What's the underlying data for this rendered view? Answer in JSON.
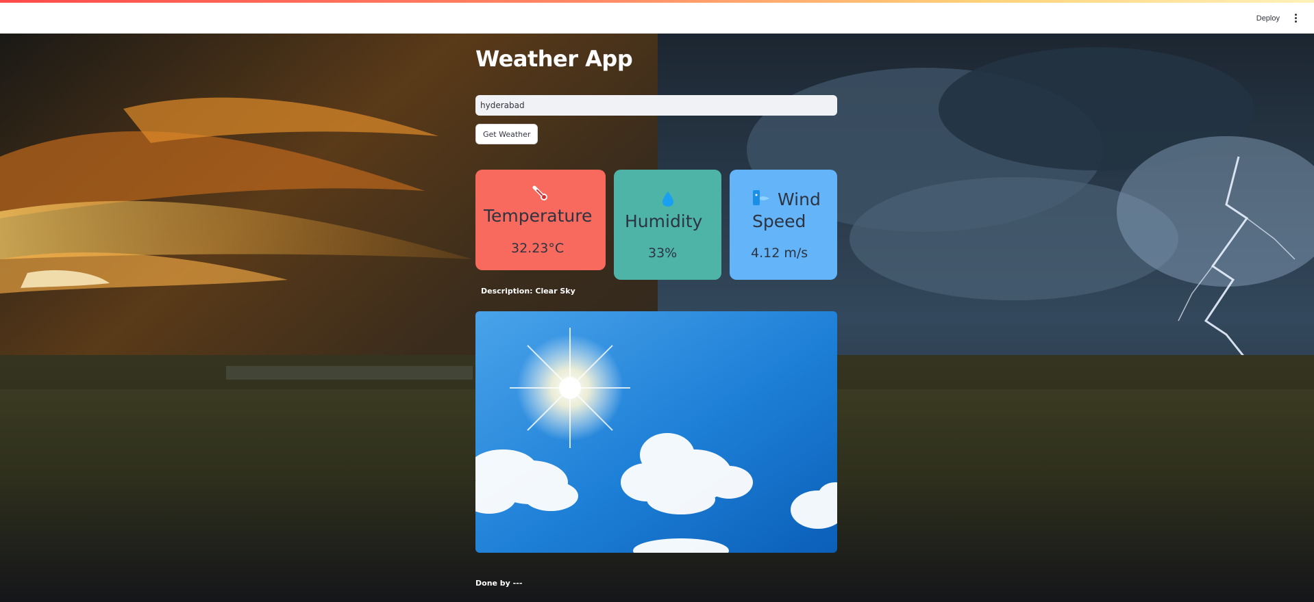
{
  "header": {
    "deploy_label": "Deploy",
    "menu_icon": "vertical-dots-icon"
  },
  "app": {
    "title": "Weather App",
    "city_input": {
      "value": "hyderabad",
      "placeholder": ""
    },
    "get_weather_label": "Get Weather"
  },
  "cards": {
    "temperature": {
      "icon": "thermometer-icon",
      "label": "Temperature",
      "value": "32.23°C",
      "color": "#f96a5e"
    },
    "humidity": {
      "icon": "water-drop-icon",
      "label": "Humidity",
      "value": "33%",
      "color": "#4db4a7"
    },
    "wind": {
      "icon": "wind-face-icon",
      "label_line1": "Wind",
      "label_line2": "Speed",
      "value": "4.12 m/s",
      "color": "#63b4f8"
    }
  },
  "description": "Description: Clear Sky",
  "image": {
    "subject": "sunny-sky-icon"
  },
  "footer": {
    "done_by": "Done by ---"
  },
  "colors": {
    "accent_gradient_start": "#ff4b4b",
    "input_bg": "#f0f2f6",
    "text_dark": "#31333f"
  }
}
